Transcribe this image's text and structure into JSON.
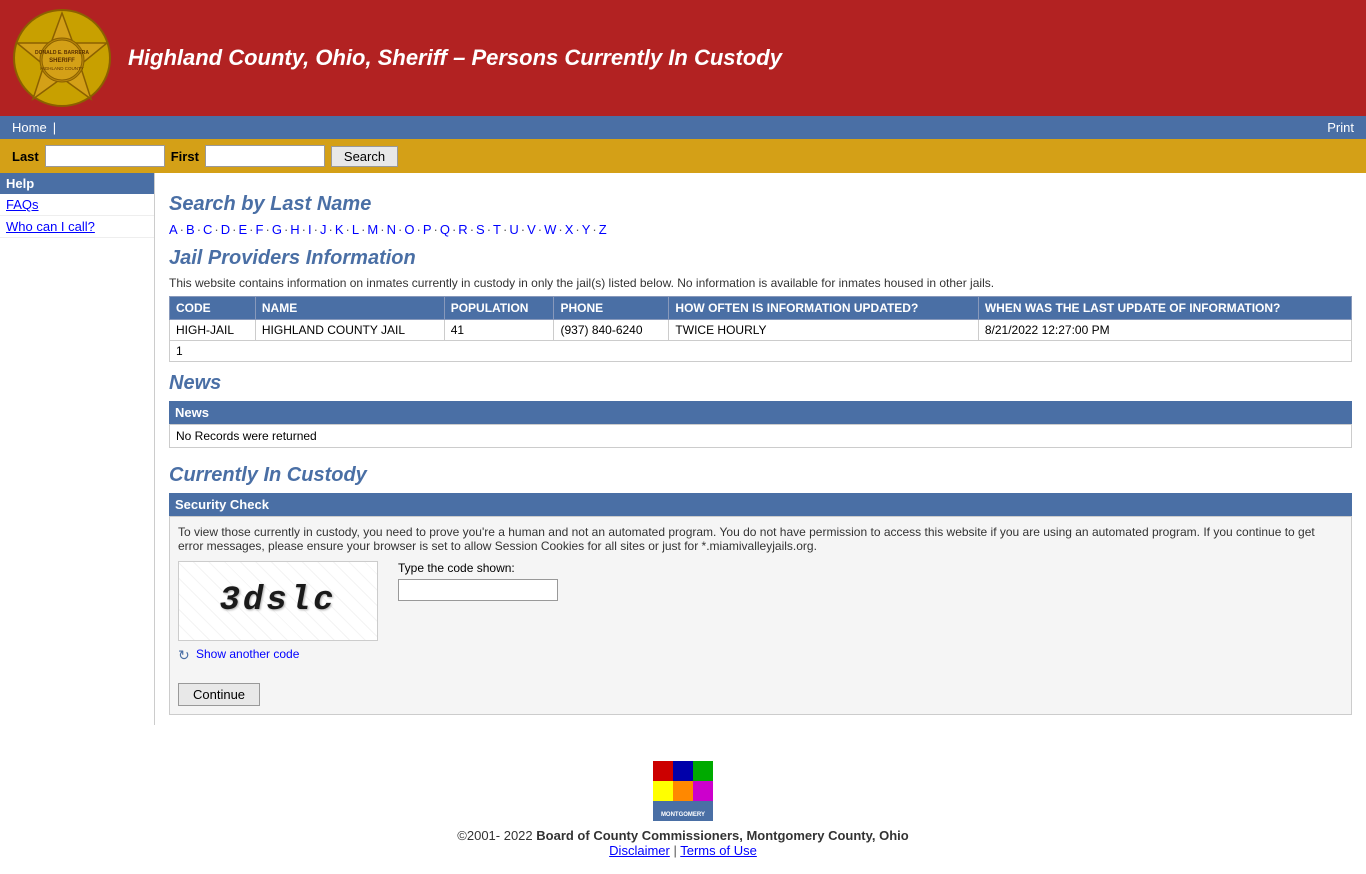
{
  "header": {
    "title": "Highland County, Ohio, Sheriff – Persons Currently In Custody",
    "logo_alt": "Highland County Sheriff Badge"
  },
  "navbar": {
    "home_label": "Home",
    "separator": "|",
    "print_label": "Print"
  },
  "searchbar": {
    "last_label": "Last",
    "first_label": "First",
    "search_button": "Search",
    "last_placeholder": "",
    "first_placeholder": ""
  },
  "sidebar": {
    "help_header": "Help",
    "links": [
      {
        "id": "faqs",
        "label": "FAQs"
      },
      {
        "id": "who-can-i-call",
        "label": "Who can I call?"
      }
    ]
  },
  "search_section": {
    "title": "Search by Last Name",
    "alphabet": [
      "A",
      "B",
      "C",
      "D",
      "E",
      "F",
      "G",
      "H",
      "I",
      "J",
      "K",
      "L",
      "M",
      "N",
      "O",
      "P",
      "Q",
      "R",
      "S",
      "T",
      "U",
      "V",
      "W",
      "X",
      "Y",
      "Z"
    ]
  },
  "jail_section": {
    "title": "Jail Providers Information",
    "description": "This website contains information on inmates currently in custody in only the jail(s) listed below. No information is available for inmates housed in other jails.",
    "table": {
      "headers": [
        "CODE",
        "NAME",
        "POPULATION",
        "PHONE",
        "HOW OFTEN IS INFORMATION UPDATED?",
        "WHEN WAS THE LAST UPDATE OF INFORMATION?"
      ],
      "rows": [
        [
          "HIGH-JAIL",
          "HIGHLAND COUNTY JAIL",
          "41",
          "(937) 840-6240",
          "TWICE HOURLY",
          "8/21/2022 12:27:00 PM"
        ]
      ],
      "footer": "1"
    }
  },
  "news_section": {
    "title": "News",
    "table_header": "News",
    "no_records": "No Records were returned"
  },
  "custody_section": {
    "title": "Currently In Custody",
    "security_header": "Security Check",
    "security_text": "To view those currently in custody, you need to prove you're a human and not an automated program. You do not have permission to access this website if you are using an automated program. If you continue to get error messages, please ensure your browser is set to allow Session Cookies for all sites or just for *.miamivalleyjails.org.",
    "captcha_label": "Type the code shown:",
    "captcha_text": "3dslc",
    "show_another": "Show another code",
    "continue_button": "Continue"
  },
  "footer": {
    "copyright": "©2001- 2022",
    "org_name": "Board of County Commissioners, Montgomery County, Ohio",
    "disclaimer_label": "Disclaimer",
    "separator": "|",
    "terms_label": "Terms of Use"
  }
}
